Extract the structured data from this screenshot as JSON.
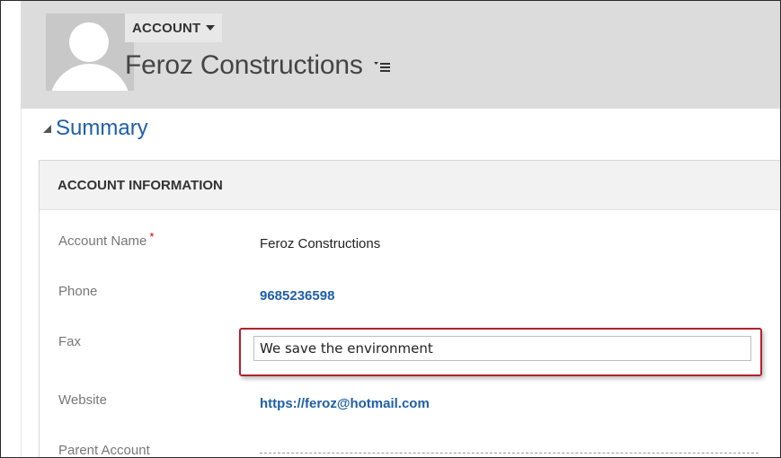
{
  "header": {
    "entity_type": "ACCOUNT",
    "record_name": "Feroz Constructions"
  },
  "summary": {
    "label": "Summary"
  },
  "section": {
    "title": "ACCOUNT INFORMATION",
    "fields": [
      {
        "label": "Account Name",
        "value": "Feroz Constructions",
        "required": "*"
      },
      {
        "label": "Phone",
        "value": "9685236598"
      },
      {
        "label": "Fax",
        "value": "We save the environment"
      },
      {
        "label": "Website",
        "value": "https://feroz@hotmail.com"
      },
      {
        "label": "Parent Account",
        "value": ""
      }
    ]
  },
  "colors": {
    "link": "#1f5fa6",
    "highlight_border": "#b3212f",
    "required": "#cc0000",
    "header_bg": "#dcdcdc"
  },
  "icons": [
    "avatar-placeholder",
    "dropdown-caret",
    "record-menu-icon",
    "collapse-triangle"
  ]
}
